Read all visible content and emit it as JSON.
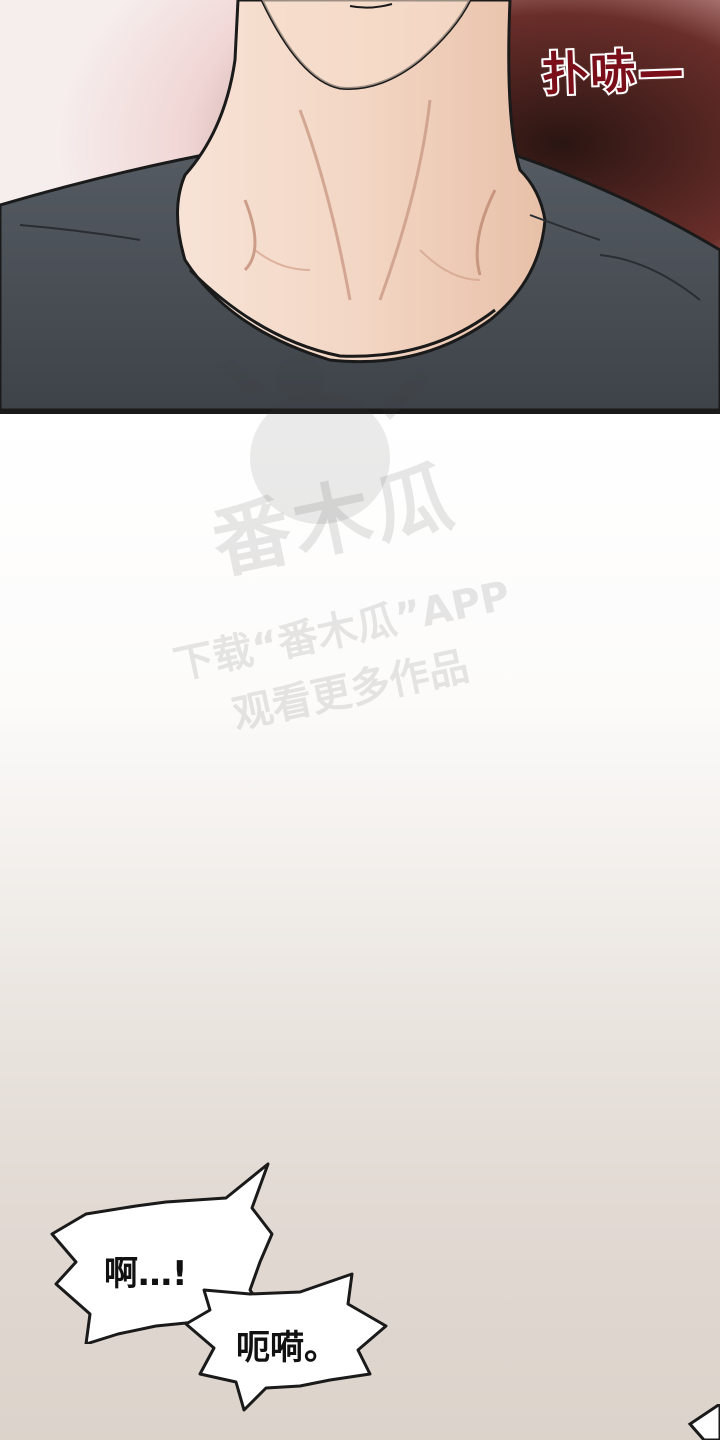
{
  "panels": {
    "top": {
      "sfx_text": "扑哧—"
    },
    "bottom": {
      "watermark": {
        "brand": "番木瓜",
        "line1": "下载“番木瓜”APP",
        "line2": "观看更多作品"
      },
      "bubbles": [
        {
          "text": "啊…!"
        },
        {
          "text": "呃嗬。"
        }
      ]
    }
  },
  "colors": {
    "shirt": "#4a4f55",
    "skin": "#f3d6c4",
    "sfx": "#7a0f1a",
    "background_top": "#f2e6e3",
    "background_bottom": "#dcd3cb"
  }
}
